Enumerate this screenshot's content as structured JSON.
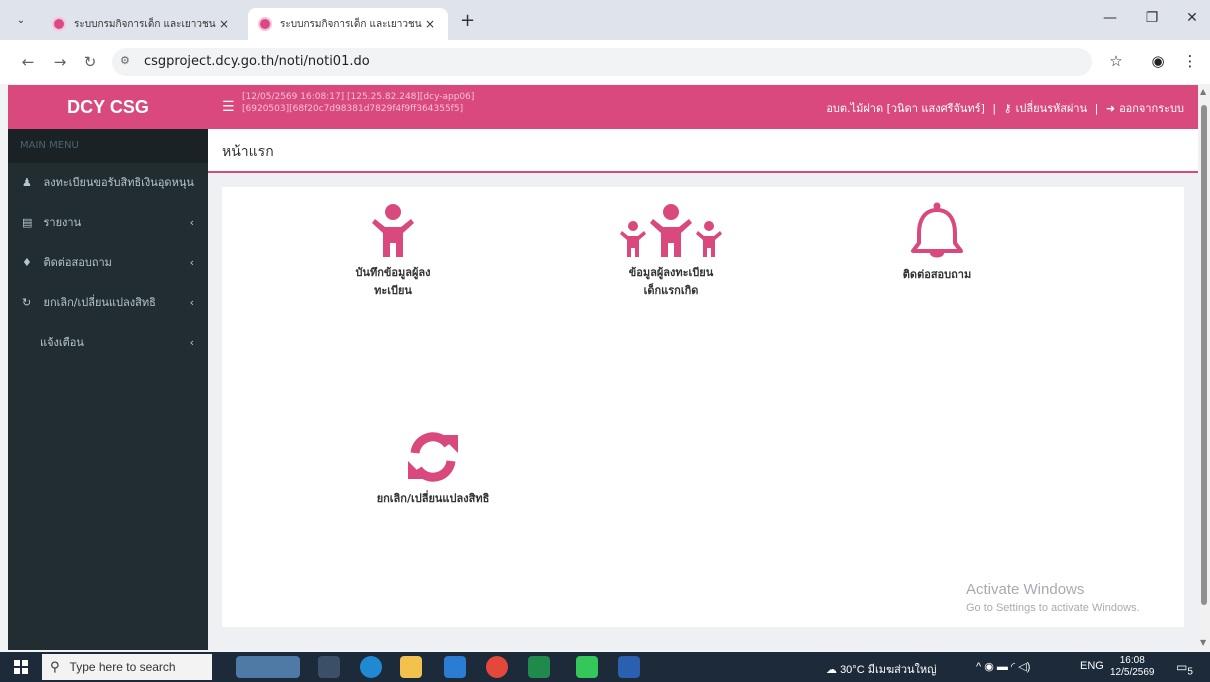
{
  "browser": {
    "tabs": [
      {
        "title": "ระบบกรมกิจการเด็ก และเยาวชน (ดย"
      },
      {
        "title": "ระบบกรมกิจการเด็ก และเยาวชน (ดย"
      }
    ],
    "tab_close": "×",
    "new_tab": "+",
    "url": "csgproject.dcy.go.th/noti/noti01.do"
  },
  "app": {
    "brand": "DCY CSG",
    "session_line1": "[12/05/2569 16:08:17] [125.25.82.248][dcy-app06]",
    "session_line2": "[6920503][68f20c7d98381d7829f4f9ff364355f5]",
    "user": "อบต.ไม้ฝาด [วนิดา แสงศรีจันทร์]",
    "separator": "|",
    "change_password": "เปลี่ยนรหัสผ่าน",
    "logout": "ออกจากระบบ"
  },
  "sidebar": {
    "header": "MAIN MENU",
    "items": [
      {
        "label": "ลงทะเบียนขอรับสิทธิเงินอุดหนุน",
        "icon": "child-icon",
        "glyph": "♟",
        "has_submenu": false
      },
      {
        "label": "รายงาน",
        "icon": "file-icon",
        "glyph": "▤",
        "has_submenu": true
      },
      {
        "label": "ติดต่อสอบถาม",
        "icon": "bell-icon",
        "glyph": "♦",
        "has_submenu": true
      },
      {
        "label": "ยกเลิก/เปลี่ยนแปลงสิทธิ",
        "icon": "refresh-icon",
        "glyph": "↻",
        "has_submenu": true
      },
      {
        "label": "แจ้งเตือน",
        "icon": "",
        "glyph": "",
        "has_submenu": true
      }
    ],
    "chevron": "‹"
  },
  "content": {
    "title": "หน้าแรก",
    "tiles": [
      {
        "label": "บันทึกข้อมูลผู้ลง\nทะเบียน",
        "icon": "child-icon"
      },
      {
        "label": "ข้อมูลผู้ลงทะเบียน\nเด็กแรกเกิด",
        "icon": "children-icon"
      },
      {
        "label": "ติดต่อสอบถาม",
        "icon": "bell-icon"
      },
      {
        "label": "ยกเลิก/เปลี่ยนแปลงสิทธิ",
        "icon": "refresh-icon"
      }
    ],
    "activate_title": "Activate Windows",
    "activate_sub": "Go to Settings to activate Windows."
  },
  "taskbar": {
    "search_placeholder": "Type here to search",
    "weather": "30°C  มีเมฆส่วนใหญ่",
    "lang": "ENG",
    "time": "16:08",
    "date": "12/5/2569",
    "notifications": "5"
  },
  "colors": {
    "accent": "#d9497e",
    "sidebar_bg": "#222d32"
  }
}
